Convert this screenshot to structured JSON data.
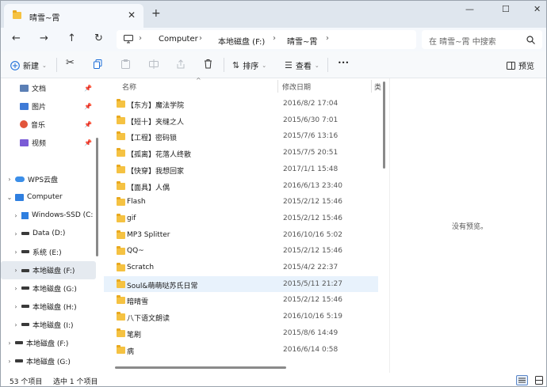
{
  "tab": {
    "title": "晴雪~霄",
    "close": "✕",
    "new": "+"
  },
  "window_controls": {
    "minimize": "—",
    "maximize": "☐",
    "close": "✕"
  },
  "address": {
    "crumbs": [
      "Computer",
      "本地磁盘 (F:)",
      "晴雪~霄"
    ],
    "separator": "›",
    "search_placeholder": "在 晴雪~霄 中搜索"
  },
  "commands": {
    "new": "新建",
    "sort": "排序",
    "view": "查看",
    "more": "•••",
    "preview": "预览"
  },
  "nav": {
    "quick": [
      {
        "label": "文档",
        "color": "#5b7fb5"
      },
      {
        "label": "图片",
        "color": "#3f7ad6"
      },
      {
        "label": "音乐",
        "color": "#e2553b"
      },
      {
        "label": "视频",
        "color": "#7a5bd6"
      }
    ],
    "items": [
      {
        "label": "WPS云盘",
        "chev": "›",
        "type": "cloud",
        "indent": 0
      },
      {
        "label": "Computer",
        "chev": "⌄",
        "type": "pc",
        "indent": 0
      },
      {
        "label": "Windows-SSD (C:",
        "chev": "›",
        "type": "win",
        "indent": 1
      },
      {
        "label": "Data (D:)",
        "chev": "›",
        "type": "drive",
        "indent": 1
      },
      {
        "label": "系统 (E:)",
        "chev": "›",
        "type": "drive",
        "indent": 1
      },
      {
        "label": "本地磁盘 (F:)",
        "chev": "›",
        "type": "drive",
        "indent": 1,
        "selected": true
      },
      {
        "label": "本地磁盘 (G:)",
        "chev": "›",
        "type": "drive",
        "indent": 1
      },
      {
        "label": "本地磁盘 (H:)",
        "chev": "›",
        "type": "drive",
        "indent": 1
      },
      {
        "label": "本地磁盘 (I:)",
        "chev": "›",
        "type": "drive",
        "indent": 1
      },
      {
        "label": "本地磁盘 (F:)",
        "chev": "›",
        "type": "drive",
        "indent": 0
      },
      {
        "label": "本地磁盘 (G:)",
        "chev": "›",
        "type": "drive",
        "indent": 0
      }
    ]
  },
  "columns": {
    "name": "名称",
    "date": "修改日期",
    "extra": "类"
  },
  "files": [
    {
      "name": "【东方】魔法学院",
      "date": "2016/8/2 17:04"
    },
    {
      "name": "【短十】夹缝之人",
      "date": "2015/6/30 7:01"
    },
    {
      "name": "【工程】密码锁",
      "date": "2015/7/6 13:16"
    },
    {
      "name": "【孤离】花落人终散",
      "date": "2015/7/5 20:51"
    },
    {
      "name": "【快穿】我想回家",
      "date": "2017/1/1 15:48"
    },
    {
      "name": "【面具】人偶",
      "date": "2016/6/13 23:40"
    },
    {
      "name": "Flash",
      "date": "2015/2/12 15:46"
    },
    {
      "name": "gif",
      "date": "2015/2/12 15:46"
    },
    {
      "name": "MP3 Splitter",
      "date": "2016/10/16 5:02"
    },
    {
      "name": "QQ~",
      "date": "2015/2/12 15:46"
    },
    {
      "name": "Scratch",
      "date": "2015/4/2 22:37"
    },
    {
      "name": "Soul&萌萌哒苏氏日常",
      "date": "2015/5/11 21:27",
      "selected": true
    },
    {
      "name": "暗晴雪",
      "date": "2015/2/12 15:46"
    },
    {
      "name": "八下语文朗读",
      "date": "2016/10/16 5:19"
    },
    {
      "name": "笔刷",
      "date": "2015/8/6 14:49"
    },
    {
      "name": "病",
      "date": "2016/6/14 0:58"
    }
  ],
  "preview": {
    "empty": "没有预览。"
  },
  "status": {
    "count": "53 个项目",
    "selected": "选中 1 个项目"
  }
}
